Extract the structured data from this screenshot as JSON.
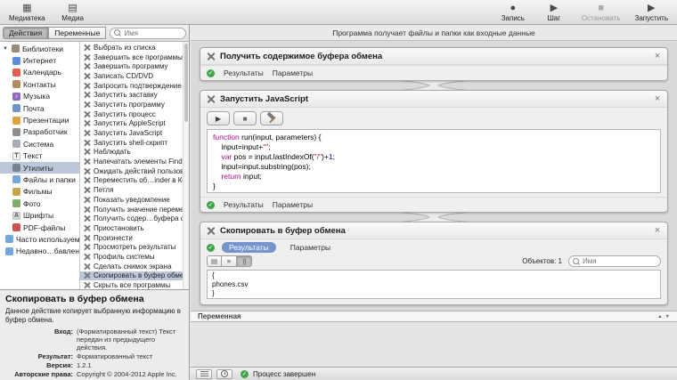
{
  "toolbar": {
    "left": [
      {
        "label": "Медиатека",
        "icon": "media-library-icon",
        "glyph": "▦"
      },
      {
        "label": "Медиа",
        "icon": "media-icon",
        "glyph": "▤"
      }
    ],
    "right": [
      {
        "label": "Запись",
        "icon": "record-icon",
        "glyph": "●"
      },
      {
        "label": "Шаг",
        "icon": "step-icon",
        "glyph": "▶"
      },
      {
        "label": "Остановить",
        "icon": "stop-icon",
        "glyph": "■",
        "disabled": true
      },
      {
        "label": "Запустить",
        "icon": "run-icon",
        "glyph": "▶"
      }
    ]
  },
  "sidebar": {
    "tabs": [
      {
        "label": "Действия",
        "selected": true
      },
      {
        "label": "Переменные"
      }
    ],
    "search_placeholder": "Имя",
    "library": [
      {
        "label": "Библиотеки",
        "icon": "library-books-icon",
        "color": "#9a8b79",
        "group": true
      },
      {
        "label": "Интернет",
        "icon": "internet-icon",
        "color": "#5b8dd9",
        "child": true
      },
      {
        "label": "Календарь",
        "icon": "calendar-icon",
        "color": "#e25c50",
        "child": true
      },
      {
        "label": "Контакты",
        "icon": "contacts-icon",
        "color": "#b08d5f",
        "child": true
      },
      {
        "label": "Музыка",
        "icon": "music-icon",
        "color": "#9068c0",
        "glyph": "♪",
        "child": true
      },
      {
        "label": "Почта",
        "icon": "mail-icon",
        "color": "#6f94c9",
        "child": true
      },
      {
        "label": "Презентации",
        "icon": "presentations-icon",
        "color": "#e0a23c",
        "child": true
      },
      {
        "label": "Разработчик",
        "icon": "developer-icon",
        "color": "#8f8f8f",
        "child": true
      },
      {
        "label": "Система",
        "icon": "system-icon",
        "color": "#a6adb5",
        "child": true
      },
      {
        "label": "Текст",
        "icon": "text-icon",
        "color": "#f4f4f4",
        "glyph": "T",
        "dark": true,
        "child": true
      },
      {
        "label": "Утилиты",
        "icon": "utilities-icon",
        "color": "#76828f",
        "child": true,
        "selected": true
      },
      {
        "label": "Файлы и папки",
        "icon": "files-folders-icon",
        "color": "#74a8dc",
        "child": true
      },
      {
        "label": "Фильмы",
        "icon": "movies-icon",
        "color": "#caa54a",
        "child": true
      },
      {
        "label": "Фото",
        "icon": "photos-icon",
        "color": "#7fb069",
        "child": true
      },
      {
        "label": "Шрифты",
        "icon": "fonts-icon",
        "color": "#d8d8d8",
        "glyph": "A",
        "dark": true,
        "child": true
      },
      {
        "label": "PDF-файлы",
        "icon": "pdf-icon",
        "color": "#d05050",
        "child": true
      },
      {
        "label": "Часто используемые",
        "icon": "frequently-used-folder-icon",
        "color": "#74a8dc"
      },
      {
        "label": "Недавно…бавленные",
        "icon": "recently-added-folder-icon",
        "color": "#74a8dc"
      }
    ],
    "actions": [
      {
        "label": "Выбрать из списка"
      },
      {
        "label": "Завершить все программы"
      },
      {
        "label": "Завершить программу"
      },
      {
        "label": "Записать CD/DVD"
      },
      {
        "label": "Запросить подтверждение"
      },
      {
        "label": "Запустить заставку"
      },
      {
        "label": "Запустить программу"
      },
      {
        "label": "Запустить процесс"
      },
      {
        "label": "Запустить AppleScript"
      },
      {
        "label": "Запустить JavaScript"
      },
      {
        "label": "Запустить shell-скрипт"
      },
      {
        "label": "Наблюдать"
      },
      {
        "label": "Напечатать элементы Finder"
      },
      {
        "label": "Ожидать действий пользователя"
      },
      {
        "label": "Переместить об…inder в Корзину"
      },
      {
        "label": "Петля"
      },
      {
        "label": "Показать уведомление"
      },
      {
        "label": "Получить значение переменной"
      },
      {
        "label": "Получить содер…буфера обмена"
      },
      {
        "label": "Приостановить"
      },
      {
        "label": "Произнести"
      },
      {
        "label": "Просмотреть результаты"
      },
      {
        "label": "Профиль системы"
      },
      {
        "label": "Сделать снимок экрана"
      },
      {
        "label": "Скопировать в буфер обмена",
        "selected": true
      },
      {
        "label": "Скрыть все программы"
      }
    ]
  },
  "description": {
    "title": "Скопировать в буфер обмена",
    "body": "Данное действие копирует выбранную информацию в буфер обмена.",
    "fields": [
      {
        "label": "Вход:",
        "value": "(Форматированный текст) Текст передан из предыдущего действия."
      },
      {
        "label": "Результат:",
        "value": "Форматированный текст"
      },
      {
        "label": "Версия:",
        "value": "1.2.1"
      },
      {
        "label": "Авторские права:",
        "value": "Copyright © 2004-2012 Apple Inc. Все права защищены."
      }
    ]
  },
  "main": {
    "input_header": "Программа получает файлы и папки как входные данные",
    "blocks": [
      {
        "title": "Получить содержимое буфера обмена",
        "footer_tabs": [
          "Результаты",
          "Параметры"
        ]
      },
      {
        "title": "Запустить JavaScript",
        "footer_tabs": [
          "Результаты",
          "Параметры"
        ],
        "code": [
          [
            {
              "t": "function",
              "c": "kw"
            },
            {
              "t": " run(input, parameters) {",
              "c": "p"
            }
          ],
          [
            {
              "t": "    input=input+",
              "c": "p"
            },
            {
              "t": "\"\"",
              "c": "str"
            },
            {
              "t": ";",
              "c": "p"
            }
          ],
          [
            {
              "t": "    ",
              "c": "p"
            },
            {
              "t": "var",
              "c": "kw"
            },
            {
              "t": " pos = input.lastIndexOf(",
              "c": "p"
            },
            {
              "t": "\"/\"",
              "c": "str"
            },
            {
              "t": ")+",
              "c": "p"
            },
            {
              "t": "1",
              "c": "num"
            },
            {
              "t": ";",
              "c": "p"
            }
          ],
          [
            {
              "t": "    input=input.substring(pos);",
              "c": "p"
            }
          ],
          [
            {
              "t": "    ",
              "c": "p"
            },
            {
              "t": "return",
              "c": "kw"
            },
            {
              "t": " input;",
              "c": "p"
            }
          ],
          [
            {
              "t": "}",
              "c": "p"
            }
          ]
        ]
      },
      {
        "title": "Скопировать в буфер обмена",
        "tabs": [
          {
            "label": "Результаты",
            "selected": true
          },
          {
            "label": "Параметры"
          }
        ],
        "objects_count": "Объектов: 1",
        "search_placeholder": "Имя",
        "result_lines": [
          "{",
          "phones.csv",
          "}"
        ]
      }
    ],
    "variable_bar_label": "Переменная",
    "status": {
      "text": "Процесс завершен"
    }
  }
}
